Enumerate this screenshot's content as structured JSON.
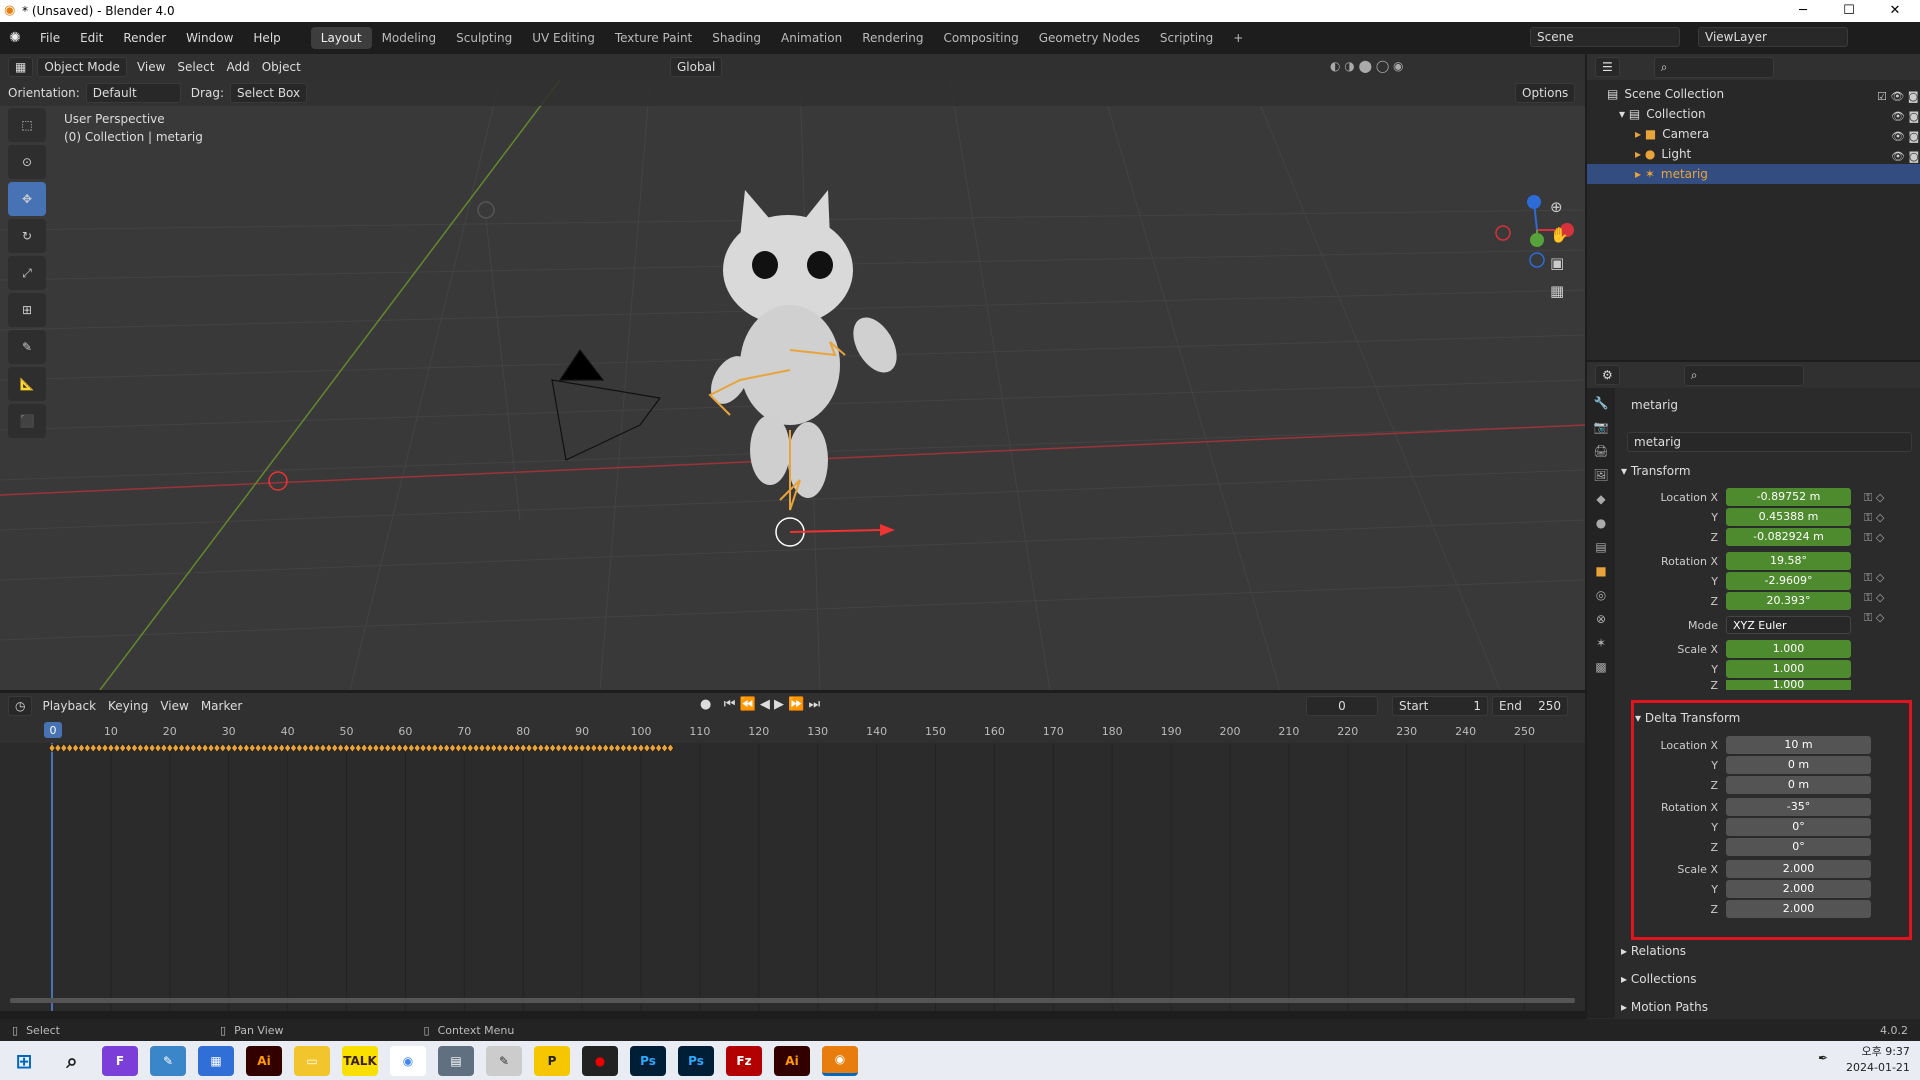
{
  "window": {
    "title": "* (Unsaved) - Blender 4.0",
    "minimize": "─",
    "maximize": "☐",
    "close": "✕"
  },
  "menu": [
    "File",
    "Edit",
    "Render",
    "Window",
    "Help"
  ],
  "workspaces": [
    "Layout",
    "Modeling",
    "Sculpting",
    "UV Editing",
    "Texture Paint",
    "Shading",
    "Animation",
    "Rendering",
    "Compositing",
    "Geometry Nodes",
    "Scripting",
    "+"
  ],
  "scene": {
    "scene_name": "Scene",
    "view_layer": "ViewLayer"
  },
  "vp_header": {
    "mode": "Object Mode",
    "view": "View",
    "select": "Select",
    "add": "Add",
    "object": "Object",
    "orientation_transform": "Global"
  },
  "tool_settings": {
    "orientation_label": "Orientation:",
    "orientation": "Default",
    "drag_label": "Drag:",
    "drag": "Select Box",
    "options": "Options"
  },
  "viewport": {
    "line1": "User Perspective",
    "line2": "(0) Collection | metarig"
  },
  "timeline": {
    "playback": "Playback",
    "keying": "Keying",
    "view": "View",
    "marker": "Marker",
    "current_frame": "0",
    "start_label": "Start",
    "start": "1",
    "end_label": "End",
    "end": "250",
    "ticks": [
      "0",
      "10",
      "20",
      "30",
      "40",
      "50",
      "60",
      "70",
      "80",
      "90",
      "100",
      "110",
      "120",
      "130",
      "140",
      "150",
      "160",
      "170",
      "180",
      "190",
      "200",
      "210",
      "220",
      "230",
      "240",
      "250"
    ]
  },
  "outliner": {
    "scene_collection": "Scene Collection",
    "collection": "Collection",
    "items": [
      "Camera",
      "Light",
      "metarig"
    ]
  },
  "properties": {
    "object_name": "metarig",
    "data_name": "metarig",
    "transform": {
      "header": "Transform",
      "loc_label": "Location X",
      "loc": [
        "-0.89752 m",
        "0.45388 m",
        "-0.082924 m"
      ],
      "rot_label": "Rotation X",
      "rot": [
        "19.58°",
        "-2.9609°",
        "20.393°"
      ],
      "mode_label": "Mode",
      "mode": "XYZ Euler",
      "scale_label": "Scale X",
      "scale": [
        "1.000",
        "1.000",
        "1.000"
      ],
      "y": "Y",
      "z": "Z"
    },
    "delta": {
      "header": "Delta Transform",
      "loc_label": "Location X",
      "loc": [
        "10 m",
        "0 m",
        "0 m"
      ],
      "rot_label": "Rotation X",
      "rot": [
        "-35°",
        "0°",
        "0°"
      ],
      "scale_label": "Scale X",
      "scale": [
        "2.000",
        "2.000",
        "2.000"
      ],
      "y": "Y",
      "z": "Z"
    },
    "collapsed": [
      "Relations",
      "Collections",
      "Motion Paths"
    ]
  },
  "status": {
    "select": "Select",
    "pan": "Pan View",
    "context": "Context Menu",
    "version": "4.0.2"
  },
  "taskbar": {
    "time": "오후 9:37",
    "date": "2024-01-21"
  },
  "colors": {
    "accent_blue": "#4772b3",
    "field_green": "#4e8b2e",
    "highlight_red": "#e0141e",
    "keyframe": "#e8a33a"
  }
}
